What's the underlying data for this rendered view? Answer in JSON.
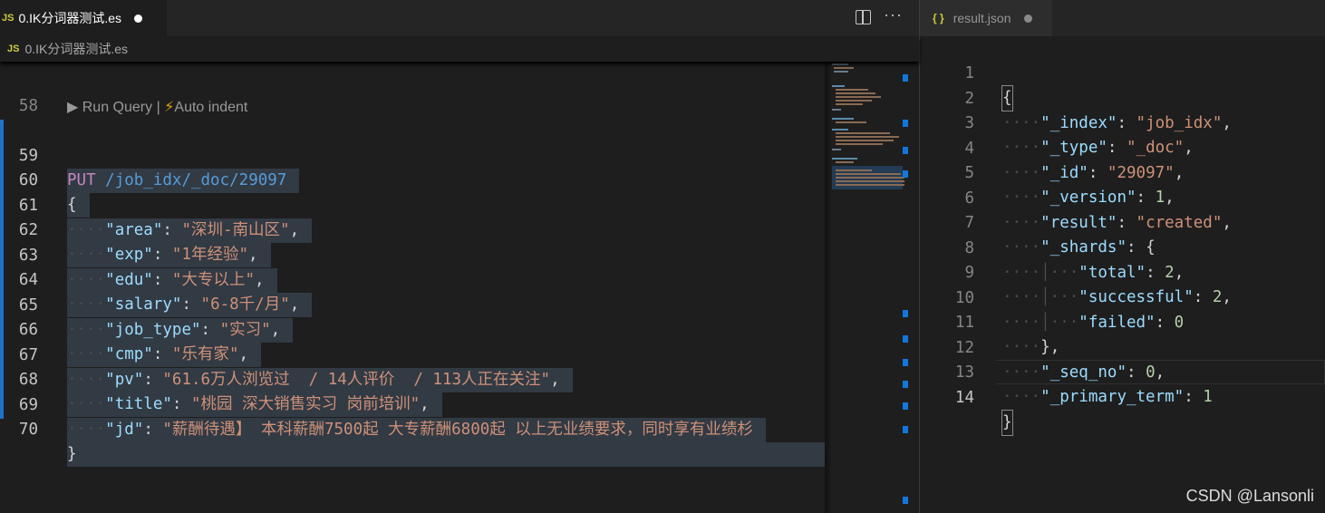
{
  "left_tab": {
    "badge": "JS",
    "title": "0.IK分词器测试.es"
  },
  "breadcrumb": {
    "badge": "JS",
    "label": "0.IK分词器测试.es"
  },
  "toolbar": {
    "more": "···"
  },
  "codelens": {
    "run": "▶ Run Query",
    "sep": " | ",
    "bolt": "⚡",
    "indent": "Auto indent"
  },
  "editor_lines": [
    {
      "no": "58"
    },
    {
      "no": "59",
      "method": "PUT",
      "url": "/job_idx/_doc/29097"
    },
    {
      "no": "60",
      "text": "{"
    },
    {
      "no": "61",
      "key": "\"area\"",
      "value": "\"深圳-南山区\""
    },
    {
      "no": "62",
      "key": "\"exp\"",
      "value": "\"1年经验\""
    },
    {
      "no": "63",
      "key": "\"edu\"",
      "value": "\"大专以上\""
    },
    {
      "no": "64",
      "key": "\"salary\"",
      "value": "\"6-8千/月\""
    },
    {
      "no": "65",
      "key": "\"job_type\"",
      "value": "\"实习\""
    },
    {
      "no": "66",
      "key": "\"cmp\"",
      "value": "\"乐有家\""
    },
    {
      "no": "67",
      "key": "\"pv\"",
      "value": "\"61.6万人浏览过  / 14人评价  / 113人正在关注\""
    },
    {
      "no": "68",
      "key": "\"title\"",
      "value": "\"桃园 深大销售实习 岗前培训\""
    },
    {
      "no": "69",
      "key": "\"jd\"",
      "value": "\"薪酬待遇】 本科薪酬7500起 大专薪酬6800起 以上无业绩要求，同时享有业绩杉"
    },
    {
      "no": "70",
      "text": "}"
    }
  ],
  "right_tab": {
    "icon": "{ }",
    "title": "result.json"
  },
  "result_lines": [
    {
      "no": "1",
      "text": "{"
    },
    {
      "no": "2",
      "key": "\"_index\"",
      "value": "\"job_idx\"",
      "tail": ","
    },
    {
      "no": "3",
      "key": "\"_type\"",
      "value": "\"_doc\"",
      "tail": ","
    },
    {
      "no": "4",
      "key": "\"_id\"",
      "value": "\"29097\"",
      "tail": ","
    },
    {
      "no": "5",
      "key": "\"_version\"",
      "num": "1",
      "tail": ","
    },
    {
      "no": "6",
      "key": "\"result\"",
      "value": "\"created\"",
      "tail": ","
    },
    {
      "no": "7",
      "key": "\"_shards\"",
      "open": "{"
    },
    {
      "no": "8",
      "key": "\"total\"",
      "num": "2",
      "tail": ","
    },
    {
      "no": "9",
      "key": "\"successful\"",
      "num": "2",
      "tail": ","
    },
    {
      "no": "10",
      "key": "\"failed\"",
      "num": "0",
      "tail": ""
    },
    {
      "no": "11",
      "text": "},"
    },
    {
      "no": "12",
      "key": "\"_seq_no\"",
      "num": "0",
      "tail": ","
    },
    {
      "no": "13",
      "key": "\"_primary_term\"",
      "num": "1",
      "tail": ""
    },
    {
      "no": "14",
      "text": "}"
    }
  ],
  "watermark": "CSDN @Lansonli"
}
